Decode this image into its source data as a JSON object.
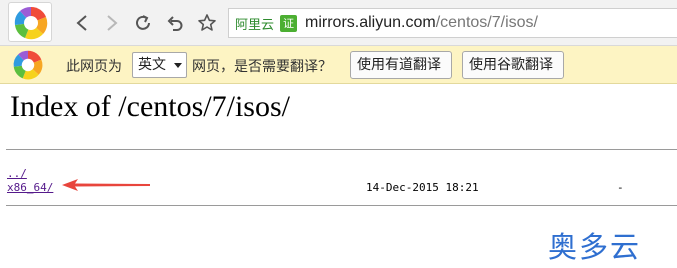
{
  "toolbar": {
    "browser_logo_icon": "360-browser-logo-icon",
    "buttons": {
      "back_icon": "chevron-left-icon",
      "forward_icon": "chevron-right-icon",
      "reload_icon": "reload-icon",
      "undo_icon": "undo-icon",
      "bookmark_icon": "star-icon"
    },
    "address": {
      "site_name": "阿里云",
      "cert_label": "证",
      "url_host": "mirrors.aliyun.com",
      "url_path": "/centos/7/isos/"
    }
  },
  "translate_bar": {
    "prefix_text": "此网页为",
    "language_selected": "英文",
    "suffix_text": "网页，是否需要翻译？",
    "youdao_button": "使用有道翻译",
    "google_button": "使用谷歌翻译"
  },
  "page": {
    "title": "Index of /centos/7/isos/",
    "entries": [
      {
        "name": "../",
        "date": "",
        "size": ""
      },
      {
        "name": "x86_64/",
        "date": "14-Dec-2015 18:21",
        "size": "-"
      }
    ]
  },
  "watermark": "奥多云",
  "colors": {
    "toolbar_bg": "#f2f2f2",
    "translate_bar_bg": "#fdf4c3",
    "link": "#551a8b",
    "arrow": "#e8453c",
    "watermark": "#2f6fd0",
    "site_name": "#2e8b2e"
  }
}
